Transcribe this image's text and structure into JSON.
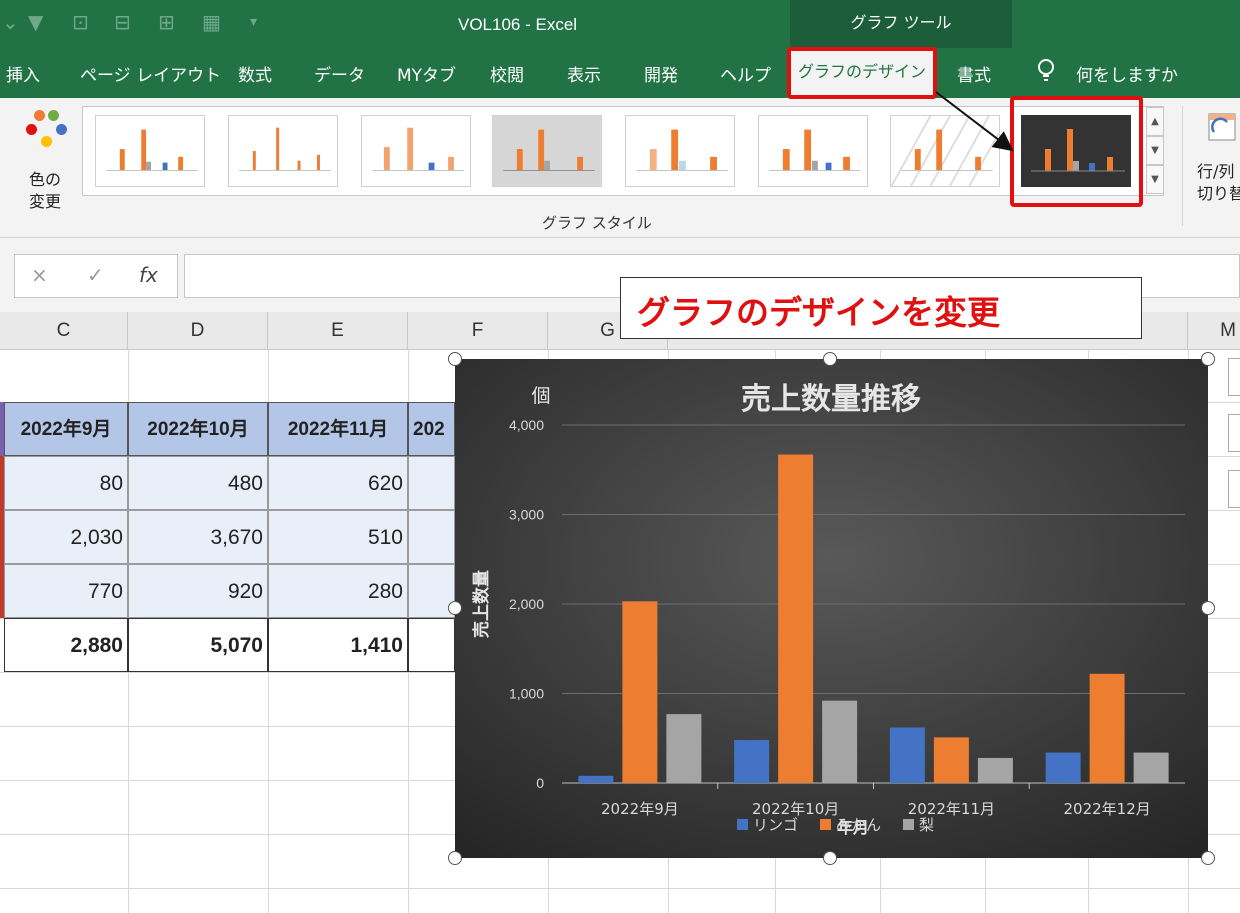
{
  "titlebar": {
    "document": "VOL106  -  Excel",
    "context_tool": "グラフ ツール"
  },
  "tabs": [
    "挿入",
    "ページ レイアウト",
    "数式",
    "データ",
    "MYタブ",
    "校閲",
    "表示",
    "開発",
    "ヘルプ",
    "グラフのデザイン",
    "書式"
  ],
  "tellme": "何をしますか",
  "ribbon": {
    "color_label_1": "色の",
    "color_label_2": "変更",
    "group_label": "グラフ スタイル",
    "switch_label_1": "行/列",
    "switch_label_2": "切り替"
  },
  "formula_bar": {
    "cancel": "×",
    "enter": "✓",
    "fx": "fx",
    "value": ""
  },
  "columns": [
    "C",
    "D",
    "E",
    "F",
    "G",
    "M"
  ],
  "table": {
    "headers": [
      "2022年9月",
      "2022年10月",
      "2022年11月",
      "202"
    ],
    "rows": [
      [
        "80",
        "480",
        "620"
      ],
      [
        "2,030",
        "3,670",
        "510"
      ],
      [
        "770",
        "920",
        "280"
      ]
    ],
    "totals": [
      "2,880",
      "5,070",
      "1,410"
    ]
  },
  "annotation": "グラフのデザインを変更",
  "colors": {
    "excel_green": "#217346",
    "highlight_red": "#e01010",
    "series_blue": "#4472c4",
    "series_orange": "#ed7d31",
    "series_gray": "#a5a5a5",
    "table_header": "#b4c6e7"
  },
  "chart_data": {
    "type": "bar",
    "title": "売上数量推移",
    "unit_label": "個",
    "ylabel": "売上数量",
    "xlabel": "年月",
    "ylim": [
      0,
      4000
    ],
    "yticks": [
      "0",
      "1,000",
      "2,000",
      "3,000",
      "4,000"
    ],
    "categories": [
      "2022年9月",
      "2022年10月",
      "2022年11月",
      "2022年12月"
    ],
    "series": [
      {
        "name": "リンゴ",
        "values": [
          80,
          480,
          620,
          340
        ],
        "color": "#4472c4"
      },
      {
        "name": "みかん",
        "values": [
          2030,
          3670,
          510,
          1220
        ],
        "color": "#ed7d31"
      },
      {
        "name": "梨",
        "values": [
          770,
          920,
          280,
          340
        ],
        "color": "#a5a5a5"
      }
    ],
    "legend": "bottom",
    "grid": true
  }
}
